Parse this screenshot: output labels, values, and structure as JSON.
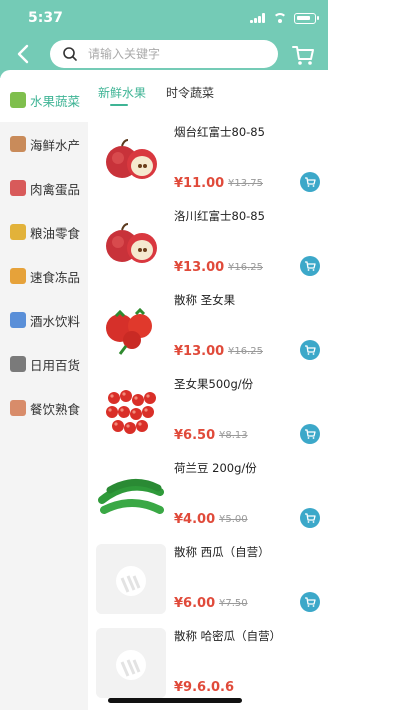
{
  "status": {
    "time": "5:37"
  },
  "search": {
    "placeholder": "请输入关键字"
  },
  "sidebar": {
    "items": [
      {
        "label": "水果蔬菜",
        "active": true,
        "color": "#7fbf4d"
      },
      {
        "label": "海鲜水产",
        "active": false,
        "color": "#c98b5a"
      },
      {
        "label": "肉禽蛋品",
        "active": false,
        "color": "#d85a5a"
      },
      {
        "label": "粮油零食",
        "active": false,
        "color": "#e2b23a"
      },
      {
        "label": "速食冻品",
        "active": false,
        "color": "#e6a23a"
      },
      {
        "label": "酒水饮料",
        "active": false,
        "color": "#5a8fd8"
      },
      {
        "label": "日用百货",
        "active": false,
        "color": "#7a7a7a"
      },
      {
        "label": "餐饮熟食",
        "active": false,
        "color": "#d88c6a"
      }
    ]
  },
  "tabs": [
    {
      "label": "新鲜水果",
      "active": true
    },
    {
      "label": "时令蔬菜",
      "active": false
    }
  ],
  "products": [
    {
      "name": "烟台红富士80-85",
      "price": "¥11.00",
      "old_price": "¥13.75",
      "image": "apple-sliced"
    },
    {
      "name": "洛川红富士80-85",
      "price": "¥13.00",
      "old_price": "¥16.25",
      "image": "apple-cut"
    },
    {
      "name": "散称 圣女果",
      "price": "¥13.00",
      "old_price": "¥16.25",
      "image": "tomato"
    },
    {
      "name": "圣女果500g/份",
      "price": "¥6.50",
      "old_price": "¥8.13",
      "image": "cherry-tomato"
    },
    {
      "name": "荷兰豆 200g/份",
      "price": "¥4.00",
      "old_price": "¥5.00",
      "image": "snow-pea"
    },
    {
      "name": "散称 西瓜（自营）",
      "price": "¥6.00",
      "old_price": "¥7.50",
      "image": "placeholder"
    },
    {
      "name": "散称 哈密瓜（自营）",
      "price": "¥9.6.0.6",
      "old_price": "",
      "image": "placeholder"
    }
  ],
  "colors": {
    "accent": "#74cbb6",
    "active_text": "#3fb495",
    "price": "#e04a3a",
    "cart_button": "#3ca8c9"
  }
}
